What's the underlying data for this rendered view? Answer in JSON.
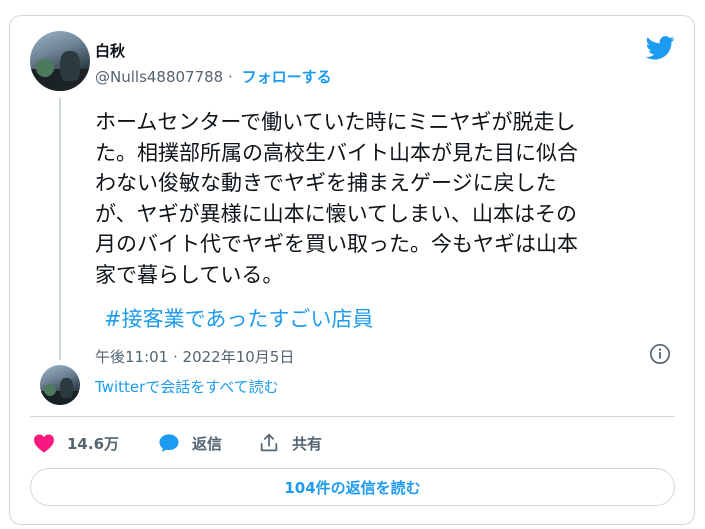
{
  "user": {
    "name": "白秋",
    "handle": "@Nulls48807788",
    "separator": "·",
    "follow_label": "フォローする"
  },
  "tweet": {
    "text_lines": [
      "ホームセンターで働いていた時にミニヤギが脱走し",
      "た。相撲部所属の高校生バイト山本が見た目に似合",
      "わない俊敏な動きでヤギを捕まえゲージに戻した",
      "が、ヤギが異様に山本に懐いてしまい、山本はその",
      "月のバイト代でヤギを買い取った。今もヤギは山本",
      "家で暮らしている。"
    ],
    "hashtag": "#接客業であったすごい店員",
    "timestamp": "午後11:01 · 2022年10月5日"
  },
  "thread": {
    "read_link": "Twitterで会話をすべて読む"
  },
  "actions": {
    "like_count": "14.6万",
    "reply_label": "返信",
    "share_label": "共有"
  },
  "read_replies_label": "104件の返信を読む",
  "icons": {
    "brand": "twitter-bird-icon",
    "info": "info-icon",
    "like": "heart-icon",
    "reply": "reply-bubble-icon",
    "share": "share-icon"
  },
  "colors": {
    "accent": "#1d9bf0",
    "like": "#f91880",
    "text": "#0f1419",
    "muted": "#536471",
    "border": "#cfd9de"
  }
}
